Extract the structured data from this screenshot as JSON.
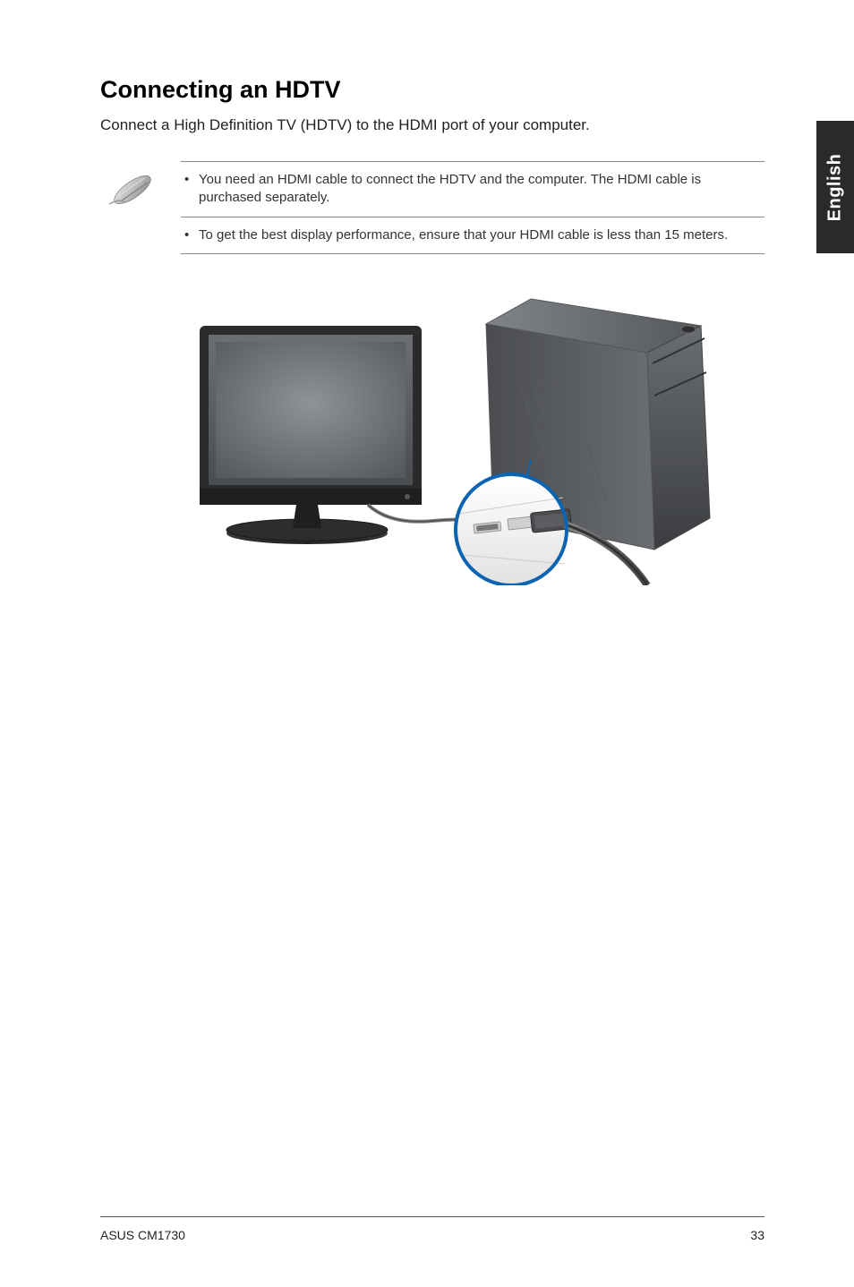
{
  "side_tab": {
    "label": "English"
  },
  "heading": "Connecting an HDTV",
  "intro": "Connect a High Definition TV (HDTV) to the HDMI port of your computer.",
  "notes": [
    "You need an HDMI cable to connect the HDTV and the computer. The HDMI cable is purchased separately.",
    "To get the best display performance, ensure that your HDMI cable is less than 15 meters."
  ],
  "footer": {
    "left": "ASUS CM1730",
    "right": "33"
  }
}
